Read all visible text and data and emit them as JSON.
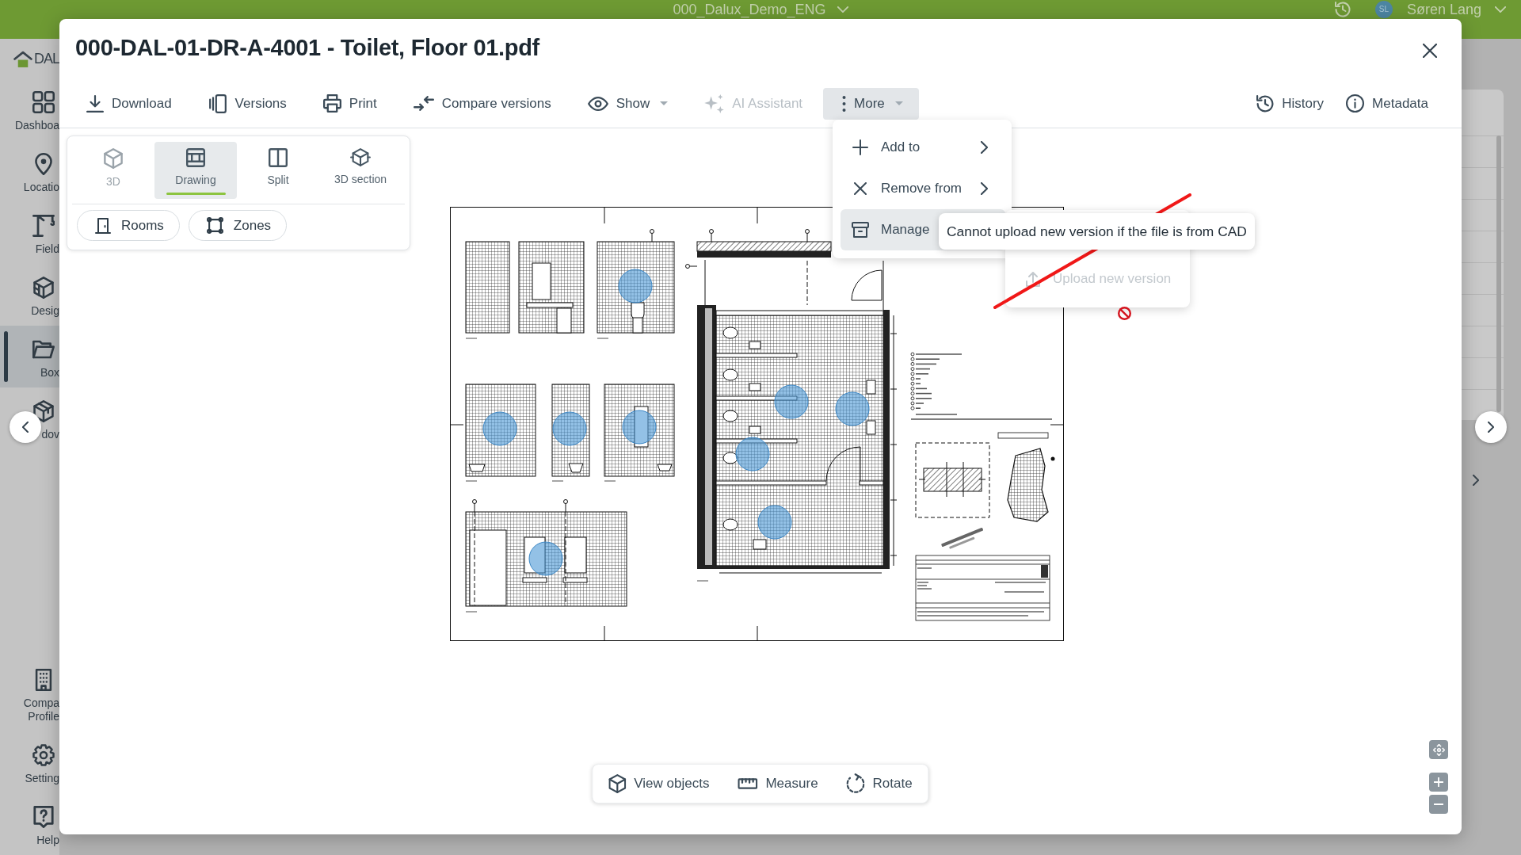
{
  "app_bar": {
    "project": "000_Dalux_Demo_ENG",
    "user_initials": "SL",
    "user_name": "Søren Lang"
  },
  "sidebar": {
    "logo_text": "DAL",
    "items": [
      {
        "label": "Dashboa",
        "selected": false
      },
      {
        "label": "Locatio",
        "selected": false
      },
      {
        "label": "Field",
        "selected": false
      },
      {
        "label": "Desig",
        "selected": false
      },
      {
        "label": "Box",
        "selected": true
      },
      {
        "label": "dov",
        "selected": false
      }
    ],
    "bottom_items": [
      {
        "label": "Compa Profile",
        "selected": false
      },
      {
        "label": "Setting",
        "selected": false
      },
      {
        "label": "Help",
        "selected": false
      }
    ]
  },
  "viewer": {
    "title": "000-DAL-01-DR-A-4001 - Toilet, Floor 01.pdf",
    "toolbar": [
      {
        "label": "Download",
        "active": false,
        "disabled": false,
        "dropdown": false
      },
      {
        "label": "Versions",
        "active": false,
        "disabled": false,
        "dropdown": false
      },
      {
        "label": "Print",
        "active": false,
        "disabled": false,
        "dropdown": false
      },
      {
        "label": "Compare versions",
        "active": false,
        "disabled": false,
        "dropdown": false
      },
      {
        "label": "Show",
        "active": false,
        "disabled": false,
        "dropdown": true
      },
      {
        "label": "AI Assistant",
        "active": false,
        "disabled": true,
        "dropdown": false
      },
      {
        "label": "More",
        "active": true,
        "disabled": false,
        "dropdown": true
      }
    ],
    "toolbar_right": [
      {
        "label": "History"
      },
      {
        "label": "Metadata"
      }
    ],
    "view_modes": [
      {
        "label": "3D",
        "selected": false,
        "disabled": true
      },
      {
        "label": "Drawing",
        "selected": true,
        "disabled": false
      },
      {
        "label": "Split",
        "selected": false,
        "disabled": false
      },
      {
        "label": "3D section",
        "selected": false,
        "disabled": false
      }
    ],
    "filters": [
      {
        "label": "Rooms"
      },
      {
        "label": "Zones"
      }
    ],
    "more_menu": [
      {
        "label": "Add to",
        "highlighted": false,
        "submenu": true
      },
      {
        "label": "Remove from",
        "highlighted": false,
        "submenu": true
      },
      {
        "label": "Manage",
        "highlighted": true,
        "submenu": false
      }
    ],
    "submenu_items": [
      {
        "label": "Upload new version",
        "disabled": true
      }
    ],
    "tooltip": "Cannot upload new version if the file is from CAD",
    "bottom_toolbar": [
      {
        "label": "View objects"
      },
      {
        "label": "Measure"
      },
      {
        "label": "Rotate"
      }
    ]
  }
}
